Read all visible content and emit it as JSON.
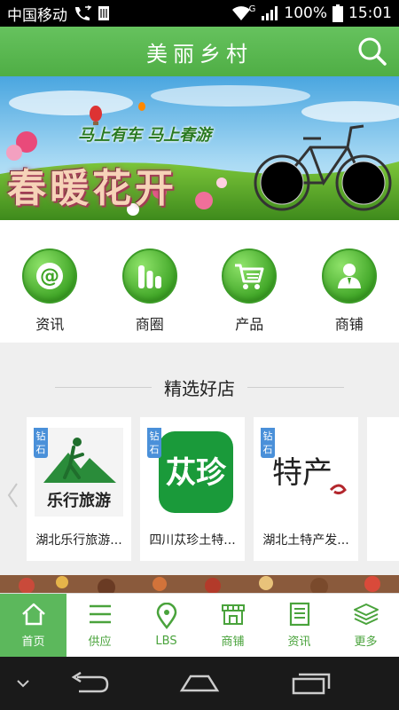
{
  "status_bar": {
    "carrier": "中国移动",
    "network_type": "G",
    "battery": "100%",
    "time": "15:01"
  },
  "header": {
    "title": "美丽乡村"
  },
  "banner": {
    "slogan": "马上有车 马上春游",
    "headline": "春暖花开"
  },
  "categories": [
    {
      "label": "资讯",
      "icon": "at-icon"
    },
    {
      "label": "商圈",
      "icon": "bar-chart-icon"
    },
    {
      "label": "产品",
      "icon": "cart-icon"
    },
    {
      "label": "商铺",
      "icon": "user-icon"
    }
  ],
  "featured": {
    "title": "精选好店",
    "shops": [
      {
        "badge": "钻石",
        "name": "湖北乐行旅游...",
        "logo_text": "乐行旅游"
      },
      {
        "badge": "钻石",
        "name": "四川苁珍土特...",
        "logo_text": "苁珍"
      },
      {
        "badge": "钻石",
        "name": "湖北土特产发...",
        "logo_text": "特产"
      }
    ]
  },
  "tabbar": [
    {
      "label": "首页",
      "icon": "home-icon",
      "active": true
    },
    {
      "label": "供应",
      "icon": "list-icon",
      "active": false
    },
    {
      "label": "LBS",
      "icon": "location-pin-icon",
      "active": false
    },
    {
      "label": "商铺",
      "icon": "store-icon",
      "active": false
    },
    {
      "label": "资讯",
      "icon": "document-icon",
      "active": false
    },
    {
      "label": "更多",
      "icon": "layers-icon",
      "active": false
    }
  ],
  "colors": {
    "primary": "#5cb85c",
    "tab_text": "#4aa33c",
    "badge": "#4a90d9"
  }
}
